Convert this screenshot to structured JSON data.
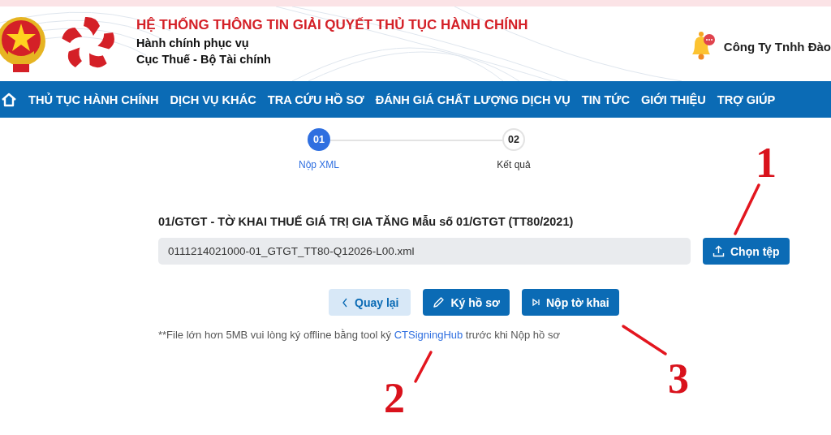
{
  "header": {
    "title": "HỆ THỐNG THÔNG TIN GIẢI QUYẾT THỦ TỤC HÀNH CHÍNH",
    "subtitle": "Hành chính phục vụ",
    "agency": "Cục Thuế - Bộ Tài chính",
    "user": "Công Ty Tnhh Đào"
  },
  "nav": {
    "items": [
      "THỦ TỤC HÀNH CHÍNH",
      "DỊCH VỤ KHÁC",
      "TRA CỨU HỒ SƠ",
      "ĐÁNH GIÁ CHẤT LƯỢNG DỊCH VỤ",
      "TIN TỨC",
      "GIỚI THIỆU",
      "TRỢ GIÚP"
    ]
  },
  "stepper": [
    {
      "number": "01",
      "label": "Nộp XML",
      "selected": true
    },
    {
      "number": "02",
      "label": "Kết quả",
      "selected": false
    }
  ],
  "form": {
    "title": "01/GTGT - TỜ KHAI THUẾ GIÁ TRỊ GIA TĂNG Mẫu số 01/GTGT (TT80/2021)",
    "file_field": {
      "value": "0111214021000-01_GTGT_TT80-Q12026-L00.xml"
    },
    "choose_button": "Chọn tệp",
    "buttons": [
      {
        "kind": "back",
        "label": "Quay lại"
      },
      {
        "kind": "sign",
        "label": "Ký hồ sơ"
      },
      {
        "kind": "submit",
        "label": "Nộp tờ khai"
      }
    ],
    "note": {
      "before": "**File lớn hơn 5MB vui lòng ký offline bằng tool ký ",
      "link": "CTSigningHub",
      "after": " trước khi Nộp hồ sơ"
    }
  },
  "annotations": [
    "1",
    "2",
    "3"
  ]
}
